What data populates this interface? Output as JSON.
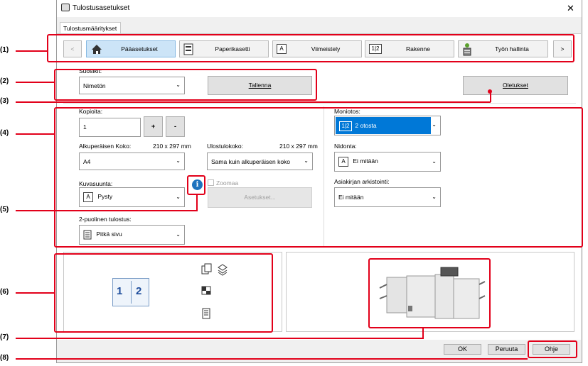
{
  "window": {
    "title": "Tulostusasetukset",
    "close": "✕"
  },
  "tab": "Tulostusmääritykset",
  "nav": {
    "prev": "<",
    "next": ">",
    "items": [
      {
        "label": "Pääasetukset",
        "icon": "home-icon"
      },
      {
        "label": "Paperikasetti",
        "icon": "paper-tray-icon"
      },
      {
        "label": "Viimeistely",
        "icon": "finishing-icon",
        "glyph": "A"
      },
      {
        "label": "Rakenne",
        "icon": "layout-icon",
        "glyph": "1|2"
      },
      {
        "label": "Työn hallinta",
        "icon": "job-management-icon"
      }
    ]
  },
  "favorites": {
    "label": "Suosikit:",
    "value": "Nimetön",
    "save": "Tallenna",
    "defaults": "Oletukset"
  },
  "copies": {
    "label": "Kopioita:",
    "value": "1",
    "plus": "+",
    "minus": "-"
  },
  "original_size": {
    "label": "Alkuperäisen Koko:",
    "dims": "210 x 297 mm",
    "value": "A4"
  },
  "output_size": {
    "label": "Ulostulokoko:",
    "dims": "210 x 297 mm",
    "value": "Sama kuin alkuperäisen koko"
  },
  "orientation": {
    "label": "Kuvasuunta:",
    "value": "Pysty",
    "glyph": "A"
  },
  "zoom": {
    "label": "Zoomaa",
    "settings": "Asetukset..."
  },
  "duplex": {
    "label": "2-puolinen tulostus:",
    "value": "Pitkä sivu"
  },
  "n_up": {
    "label": "Moniotos:",
    "value": "2 otosta",
    "glyph": "1|2"
  },
  "binding": {
    "label": "Nidonta:",
    "value": "Ei mitään",
    "glyph": "A"
  },
  "archiving": {
    "label": "Asiakirjan arkistointi:",
    "value": "Ei mitään"
  },
  "preview": {
    "page1": "1",
    "page2": "2"
  },
  "footer": {
    "ok": "OK",
    "cancel": "Peruuta",
    "help": "Ohje"
  },
  "callouts": [
    "(1)",
    "(2)",
    "(3)",
    "(4)",
    "(5)",
    "(6)",
    "(7)",
    "(8)"
  ],
  "colors": {
    "accent": "#0078d7",
    "callout": "#e2001a",
    "selected_nav": "#cce4f7"
  }
}
